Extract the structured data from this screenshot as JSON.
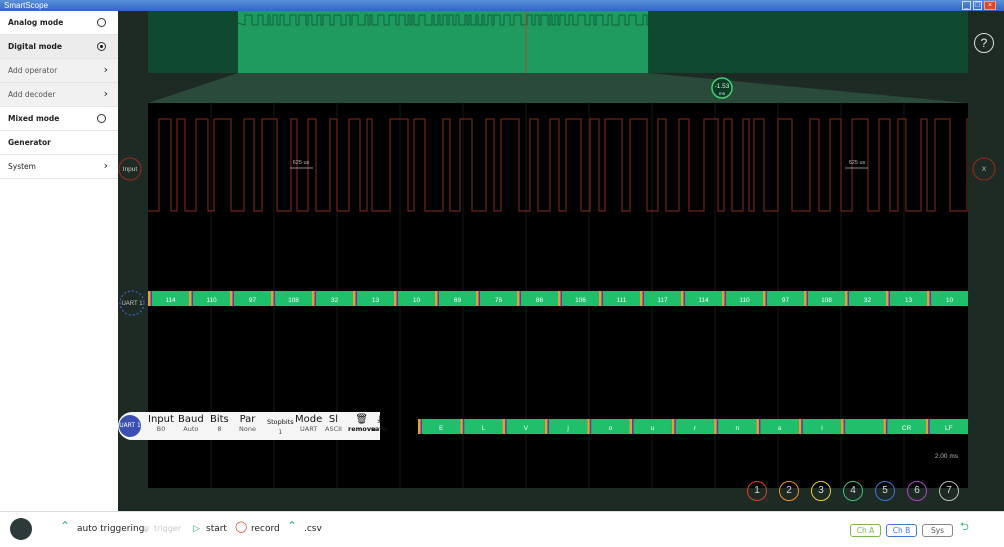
{
  "window": {
    "title": "SmartScope"
  },
  "sidebar": {
    "items": [
      {
        "label": "Analog mode",
        "control": "radio-off"
      },
      {
        "label": "Digital mode",
        "control": "radio-on"
      },
      {
        "label": "Add operator",
        "control": "chevron"
      },
      {
        "label": "Add decoder",
        "control": "chevron"
      },
      {
        "label": "Mixed mode",
        "control": "radio-off"
      },
      {
        "label": "Generator",
        "control": "none"
      },
      {
        "label": "System",
        "control": "chevron"
      }
    ]
  },
  "scope": {
    "cursor_delta": "-1.53",
    "cursor_delta_unit": "ms",
    "input_label": "Input",
    "x_label": "X",
    "period_label_left": "625 us",
    "period_label_right": "625 us",
    "timebase": "2.00 ms",
    "uart_label": "UART 1",
    "uart_values": [
      "114",
      "110",
      "97",
      "108",
      "32",
      "13",
      "10",
      "69",
      "76",
      "86",
      "106",
      "111",
      "117",
      "114",
      "110",
      "97",
      "108",
      "32",
      "13",
      "10"
    ],
    "ascii_values": [
      "E",
      "L",
      "V",
      "j",
      "o",
      "u",
      "r",
      "n",
      "a",
      "l",
      "",
      "CR",
      "LF"
    ]
  },
  "decoder_config": {
    "uart_badge": "UART 1",
    "fields": [
      {
        "head": "Input",
        "val": "B0"
      },
      {
        "head": "Baud",
        "val": "Auto"
      },
      {
        "head": "Bits",
        "val": "8"
      },
      {
        "head": "Par",
        "val": "None"
      },
      {
        "head": "Stopbits",
        "val": "1"
      },
      {
        "head": "Mode",
        "val": "UART"
      },
      {
        "head": "Sl",
        "val": "ASCII"
      }
    ],
    "remove_label": "remove",
    "save_label": "save"
  },
  "channels": [
    {
      "label": "1",
      "color": "#e0402b"
    },
    {
      "label": "2",
      "color": "#f0902a"
    },
    {
      "label": "3",
      "color": "#e8d32a"
    },
    {
      "label": "4",
      "color": "#3fc07a"
    },
    {
      "label": "5",
      "color": "#3e78d8"
    },
    {
      "label": "6",
      "color": "#b048c8"
    },
    {
      "label": "7",
      "color": "#bbbbbb"
    }
  ],
  "help": {
    "label": "?"
  },
  "bottombar": {
    "auto_triggering": "auto triggering",
    "trigger": "trigger",
    "start": "start",
    "record": "record",
    "csv": ".csv",
    "ch_a": "Ch A",
    "ch_b": "Ch B",
    "sys": "Sys"
  },
  "colors": {
    "accent_green": "#1fbf6c",
    "panel": "#1e2a24",
    "trace": "#8a2a1e"
  }
}
